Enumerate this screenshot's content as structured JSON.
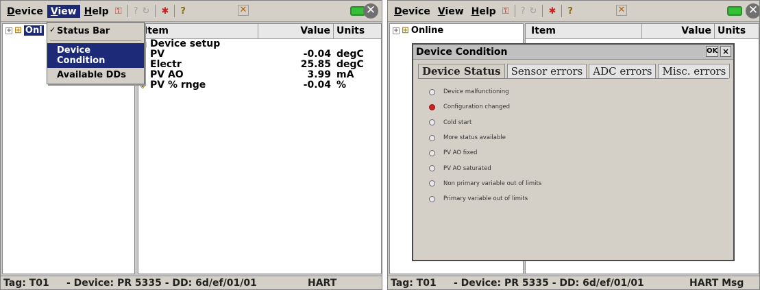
{
  "left": {
    "menu": {
      "device": "Device",
      "view": "View",
      "help": "Help"
    },
    "view_menu": {
      "status_bar": "Status Bar",
      "device_condition": "Device Condition",
      "available_dds": "Available DDs"
    },
    "tree": {
      "root": "Onl"
    },
    "grid": {
      "headers": {
        "item": "Item",
        "value": "Value",
        "units": "Units"
      },
      "rows": [
        {
          "item": "Device setup",
          "value": "",
          "units": ""
        },
        {
          "item": "PV",
          "value": "-0.04",
          "units": "degC"
        },
        {
          "item": "Electr",
          "value": "25.85",
          "units": "degC"
        },
        {
          "item": "PV AO",
          "value": "3.99",
          "units": "mA"
        },
        {
          "item": "PV % rnge",
          "value": "-0.04",
          "units": "%"
        }
      ]
    },
    "status": {
      "tag": "Tag: T01",
      "device": "- Device: PR 5335 - DD: 6d/ef/01/01",
      "protocol": "HART"
    }
  },
  "right": {
    "menu": {
      "device": "Device",
      "view": "View",
      "help": "Help"
    },
    "tree": {
      "root": "Online"
    },
    "grid": {
      "headers": {
        "item": "Item",
        "value": "Value",
        "units": "Units"
      }
    },
    "dialog": {
      "title": "Device Condition",
      "ok": "OK",
      "close": "×",
      "tabs": [
        "Device Status",
        "Sensor errors",
        "ADC errors",
        "Misc. errors"
      ],
      "active_tab": "Device Status",
      "conditions": [
        {
          "label": "Device malfunctioning",
          "active": false
        },
        {
          "label": "Configuration changed",
          "active": true
        },
        {
          "label": "Cold start",
          "active": false
        },
        {
          "label": "More status available",
          "active": false
        },
        {
          "label": "PV AO fixed",
          "active": false
        },
        {
          "label": "PV AO saturated",
          "active": false
        },
        {
          "label": "Non primary variable out of limits",
          "active": false
        },
        {
          "label": "Primary variable out of limits",
          "active": false
        }
      ]
    },
    "status": {
      "tag": "Tag: T01",
      "device": "- Device: PR 5335 - DD: 6d/ef/01/01",
      "protocol": "HART Msg"
    }
  },
  "colors": {
    "highlight": "#1c2a78",
    "active_led": "#d02020",
    "battery": "#35c135"
  },
  "icons": [
    "device-lock-icon",
    "help-cursor-icon",
    "refresh-icon",
    "settings-icon",
    "question-icon",
    "move-icon",
    "battery-icon",
    "close-icon"
  ]
}
